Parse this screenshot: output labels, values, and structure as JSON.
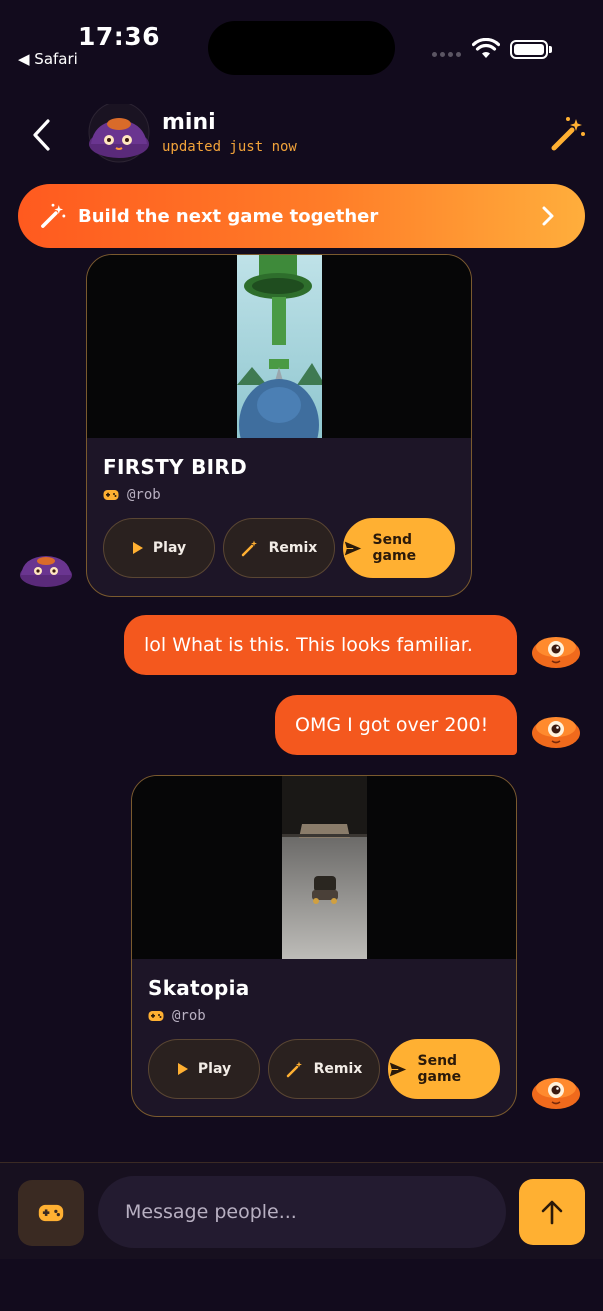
{
  "status_bar": {
    "time": "17:36",
    "back_app": "◀ Safari"
  },
  "header": {
    "name": "mini",
    "status": "updated just now"
  },
  "banner": {
    "label": "Build the next game together"
  },
  "games": [
    {
      "title": "FIRSTY BIRD",
      "author": "@rob",
      "play_label": "Play",
      "remix_label": "Remix",
      "send_label": "Send game"
    },
    {
      "title": "Skatopia",
      "author": "@rob",
      "play_label": "Play",
      "remix_label": "Remix",
      "send_label": "Send game"
    }
  ],
  "messages": [
    {
      "text": "lol What is this. This looks familiar."
    },
    {
      "text": "OMG I got over 200!"
    }
  ],
  "composer": {
    "placeholder": "Message people..."
  },
  "colors": {
    "accent": "#ff5a1f",
    "button": "#ffb032",
    "background": "#120b1d"
  }
}
